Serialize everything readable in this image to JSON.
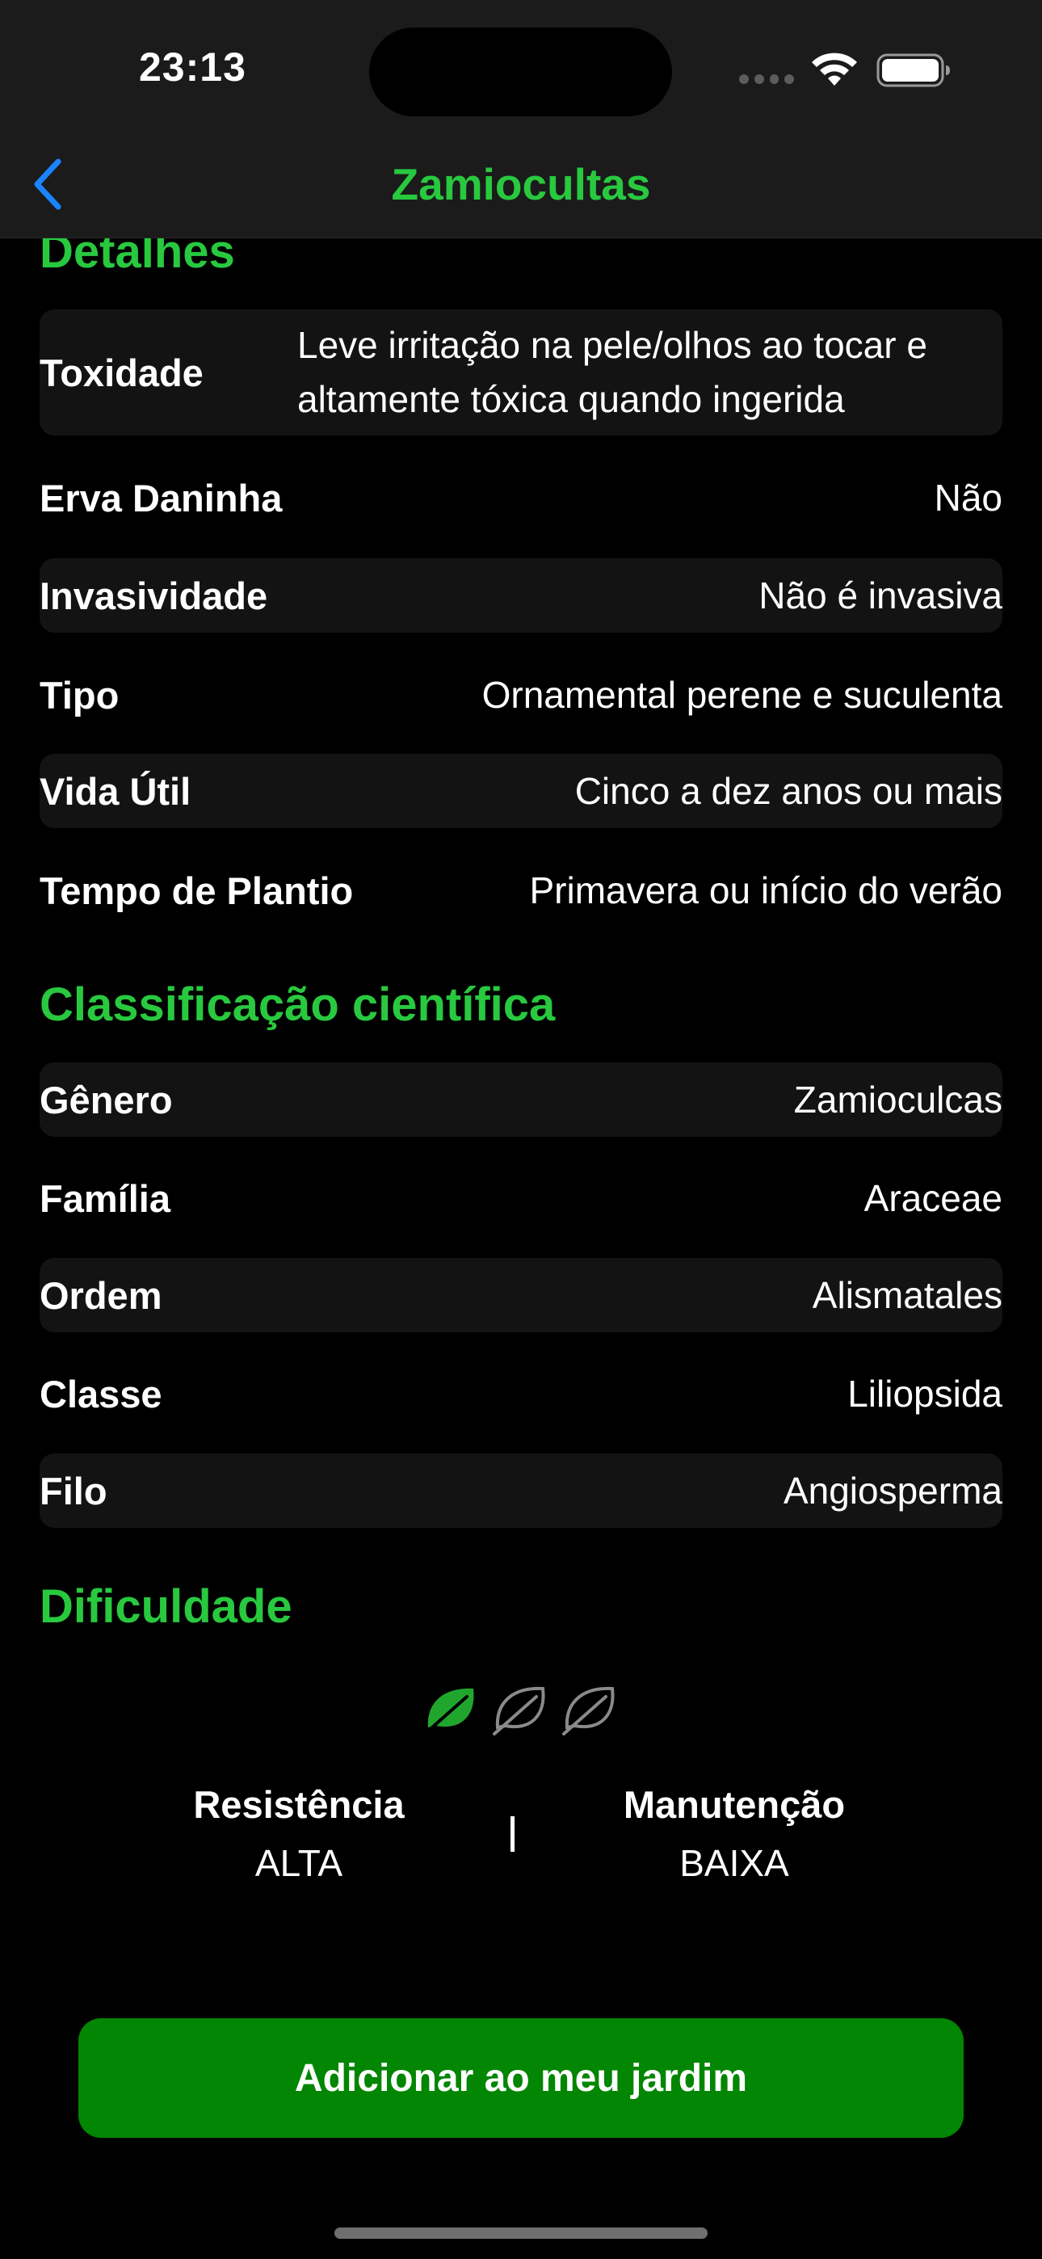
{
  "status_bar": {
    "time": "23:13"
  },
  "nav": {
    "title": "Zamiocultas",
    "back_icon": "chevron-left-icon"
  },
  "details": {
    "title": "Detalhes",
    "rows": [
      {
        "label": "Toxidade",
        "value": "Leve irritação na pele/olhos ao tocar e altamente tóxica quando ingerida"
      },
      {
        "label": "Erva Daninha",
        "value": "Não"
      },
      {
        "label": "Invasividade",
        "value": "Não é invasiva"
      },
      {
        "label": "Tipo",
        "value": "Ornamental perene e suculenta"
      },
      {
        "label": "Vida Útil",
        "value": "Cinco a dez anos ou mais"
      },
      {
        "label": "Tempo de Plantio",
        "value": "Primavera ou início do verão"
      }
    ]
  },
  "classification": {
    "title": "Classificação científica",
    "rows": [
      {
        "label": "Gênero",
        "value": "Zamioculcas"
      },
      {
        "label": "Família",
        "value": "Araceae"
      },
      {
        "label": "Ordem",
        "value": "Alismatales"
      },
      {
        "label": "Classe",
        "value": "Liliopsida"
      },
      {
        "label": "Filo",
        "value": "Angiosperma"
      }
    ]
  },
  "difficulty": {
    "title": "Dificuldade",
    "level": 1,
    "max_level": 3,
    "active_color": "#21a62d",
    "inactive_color": "#8a8a8a",
    "resistance": {
      "label": "Resistência",
      "value": "ALTA"
    },
    "maintenance": {
      "label": "Manutenção",
      "value": "BAIXA"
    }
  },
  "actions": {
    "add_label": "Adicionar ao meu jardim"
  },
  "colors": {
    "accent": "#28c93f",
    "button": "#038603",
    "row_shade": "#131313",
    "link": "#1a84ff"
  }
}
